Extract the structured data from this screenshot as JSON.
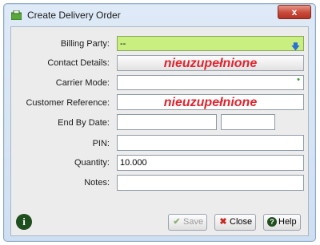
{
  "window": {
    "title": "Create Delivery Order",
    "close_glyph": "x",
    "icon": "delivery-order-icon"
  },
  "form": {
    "billing_party": {
      "label": "Billing Party:",
      "value": "--"
    },
    "contact_details": {
      "label": "Contact Details:",
      "placeholder_text": "nieuzupełnione"
    },
    "carrier_mode": {
      "label": "Carrier Mode:",
      "value": ""
    },
    "customer_reference": {
      "label": "Customer Reference:",
      "placeholder_text": "nieuzupełnione"
    },
    "end_by_date": {
      "label": "End By Date:",
      "date": "",
      "time": ""
    },
    "pin": {
      "label": "PIN:",
      "value": ""
    },
    "quantity": {
      "label": "Quantity:",
      "value": "10.000"
    },
    "notes": {
      "label": "Notes:",
      "value": ""
    }
  },
  "buttons": {
    "info_glyph": "i",
    "save": "Save",
    "close": "Close",
    "help": "Help"
  },
  "colors": {
    "required_field": "#c9ef80",
    "placeholder_text": "#e0242e",
    "title_close": "#c8493a"
  }
}
